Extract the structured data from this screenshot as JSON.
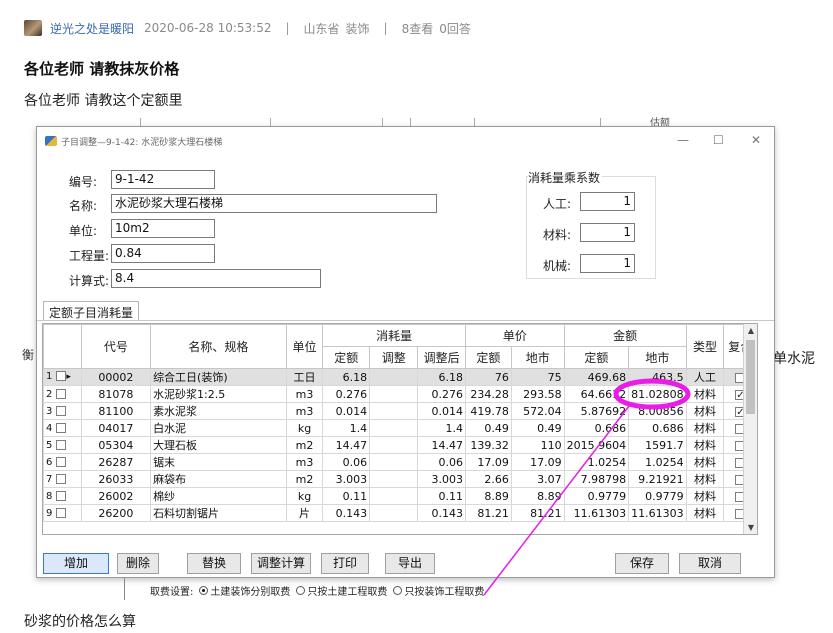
{
  "post": {
    "author": "逆光之处是暖阳",
    "datetime": "2020-06-28 10:53:52",
    "region": "山东省",
    "category": "装饰",
    "views": "8查看",
    "answers": "0回答",
    "title": "各位老师 请教抹灰价格",
    "body_line1": "各位老师  请教这个定额里",
    "body_line2": "砂浆的价格怎么算",
    "side_text": "单水泥",
    "left_fragment": "衡",
    "bg_header_label": "估额"
  },
  "dialog": {
    "title": "子目调整—9-1-42: 水泥砂浆大理石楼梯",
    "minimize": "—",
    "maximize": "☐",
    "close": "✕",
    "fields": {
      "code_label": "编号:",
      "code_value": "9-1-42",
      "name_label": "名称:",
      "name_value": "水泥砂浆大理石楼梯",
      "unit_label": "单位:",
      "unit_value": "10m2",
      "qty_label": "工程量:",
      "qty_value": "0.84",
      "formula_label": "计算式:",
      "formula_value": "8.4"
    },
    "coef": {
      "title": "消耗量乘系数",
      "labor_label": "人工:",
      "labor_value": "1",
      "material_label": "材料:",
      "material_value": "1",
      "machine_label": "机械:",
      "machine_value": "1"
    },
    "tab_label": "定额子目消耗量",
    "table": {
      "headers": {
        "code": "代号",
        "name": "名称、规格",
        "unit": "单位",
        "consumption": "消耗量",
        "c_quota": "定额",
        "c_adjust": "调整",
        "c_after": "调整后",
        "price": "单价",
        "p_quota": "定额",
        "p_market": "地市",
        "amount": "金额",
        "a_quota": "定额",
        "a_market": "地市",
        "type": "类型",
        "compound": "复合"
      },
      "rows": [
        {
          "no": "1",
          "code": "00002",
          "name": "综合工日(装饰)",
          "unit": "工日",
          "c_quota": "6.18",
          "c_adjust": "",
          "c_after": "6.18",
          "p_quota": "76",
          "p_market": "75",
          "a_quota": "469.68",
          "a_market": "463.5",
          "type": "人工",
          "compound": false,
          "selected": true
        },
        {
          "no": "2",
          "code": "81078",
          "name": "水泥砂浆1:2.5",
          "unit": "m3",
          "c_quota": "0.276",
          "c_adjust": "",
          "c_after": "0.276",
          "p_quota": "234.28",
          "p_market": "293.58",
          "a_quota": "64.6612",
          "a_market": "81.02808",
          "type": "材料",
          "compound": true,
          "selected": false
        },
        {
          "no": "3",
          "code": "81100",
          "name": "素水泥浆",
          "unit": "m3",
          "c_quota": "0.014",
          "c_adjust": "",
          "c_after": "0.014",
          "p_quota": "419.78",
          "p_market": "572.04",
          "a_quota": "5.87692",
          "a_market": "8.00856",
          "type": "材料",
          "compound": true,
          "selected": false
        },
        {
          "no": "4",
          "code": "04017",
          "name": "白水泥",
          "unit": "kg",
          "c_quota": "1.4",
          "c_adjust": "",
          "c_after": "1.4",
          "p_quota": "0.49",
          "p_market": "0.49",
          "a_quota": "0.686",
          "a_market": "0.686",
          "type": "材料",
          "compound": false,
          "selected": false
        },
        {
          "no": "5",
          "code": "05304",
          "name": "大理石板",
          "unit": "m2",
          "c_quota": "14.47",
          "c_adjust": "",
          "c_after": "14.47",
          "p_quota": "139.32",
          "p_market": "110",
          "a_quota": "2015.9604",
          "a_market": "1591.7",
          "type": "材料",
          "compound": false,
          "selected": false
        },
        {
          "no": "6",
          "code": "26287",
          "name": "锯末",
          "unit": "m3",
          "c_quota": "0.06",
          "c_adjust": "",
          "c_after": "0.06",
          "p_quota": "17.09",
          "p_market": "17.09",
          "a_quota": "1.0254",
          "a_market": "1.0254",
          "type": "材料",
          "compound": false,
          "selected": false
        },
        {
          "no": "7",
          "code": "26033",
          "name": "麻袋布",
          "unit": "m2",
          "c_quota": "3.003",
          "c_adjust": "",
          "c_after": "3.003",
          "p_quota": "2.66",
          "p_market": "3.07",
          "a_quota": "7.98798",
          "a_market": "9.21921",
          "type": "材料",
          "compound": false,
          "selected": false
        },
        {
          "no": "8",
          "code": "26002",
          "name": "棉纱",
          "unit": "kg",
          "c_quota": "0.11",
          "c_adjust": "",
          "c_after": "0.11",
          "p_quota": "8.89",
          "p_market": "8.89",
          "a_quota": "0.9779",
          "a_market": "0.9779",
          "type": "材料",
          "compound": false,
          "selected": false
        },
        {
          "no": "9",
          "code": "26200",
          "name": "石料切割锯片",
          "unit": "片",
          "c_quota": "0.143",
          "c_adjust": "",
          "c_after": "0.143",
          "p_quota": "81.21",
          "p_market": "81.21",
          "a_quota": "11.61303",
          "a_market": "11.61303",
          "type": "材料",
          "compound": false,
          "selected": false
        }
      ]
    },
    "buttons": {
      "add": "增加",
      "delete": "删除",
      "replace": "替换",
      "adjust_calc": "调整计算",
      "print": "打印",
      "export": "导出",
      "save": "保存",
      "cancel": "取消"
    },
    "fee_settings": {
      "label": "取费设置:",
      "opt1": "土建装饰分别取费",
      "opt2": "只按土建工程取费",
      "opt3": "只按装饰工程取费",
      "selected": "opt1"
    }
  },
  "annotation": {
    "color": "#e81ee8",
    "target_value": "81.02808"
  }
}
